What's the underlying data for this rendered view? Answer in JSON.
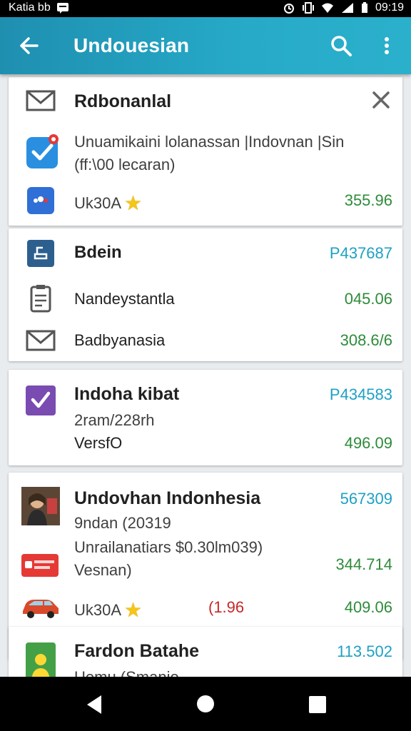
{
  "status_bar": {
    "carrier": "Katia bb",
    "time": "09:19"
  },
  "app_bar": {
    "title": "Undouesian",
    "back_icon": "arrow-back-icon",
    "search_icon": "search-icon",
    "more_icon": "more-vert-icon"
  },
  "cards": [
    {
      "header_icon": "mail-icon",
      "title": "Rdbonanlal",
      "close_icon": "close-icon",
      "rows": [
        {
          "icon": "check-app-icon",
          "line1": "Unuamikaini lolanassan |Indovnan |Sin",
          "line2": "(ff:\\00 lecaran)"
        },
        {
          "icon": "app-dots-icon",
          "label": "Uk30A",
          "star": "★",
          "value": "355.96"
        }
      ]
    },
    {
      "rows": [
        {
          "icon": "printer-icon",
          "label": "Bdein",
          "value": "P437687"
        },
        {
          "icon": "clipboard-icon",
          "label": "Nandeystantla",
          "value": "045.06"
        },
        {
          "icon": "mail-icon",
          "label": "Badbyanasia",
          "value": "308.6/6"
        }
      ]
    },
    {
      "icon": "check-purple-icon",
      "title": "Indoha kibat",
      "value": "P434583",
      "sub": "2ram/228rh",
      "label": "VersfO",
      "amount": "496.09"
    },
    {
      "avatar_icon": "person-photo-icon",
      "title": "Undovhan Indonhesia",
      "value": "567309",
      "sub": "9ndan (20319",
      "line": "Unrailanatiars $0.30lm039)",
      "line_b": "Vesnan)",
      "line_value": "344.714",
      "promo_icon": "promo-red-icon",
      "car_icon": "car-icon",
      "label": "Uk30A",
      "star": "★",
      "red_value": "(1.96",
      "amount": "409.06"
    },
    {
      "icon": "person-green-icon",
      "title": "Fardon Batahe",
      "value": "113.502",
      "sub": "Uemu (Smanio"
    }
  ]
}
